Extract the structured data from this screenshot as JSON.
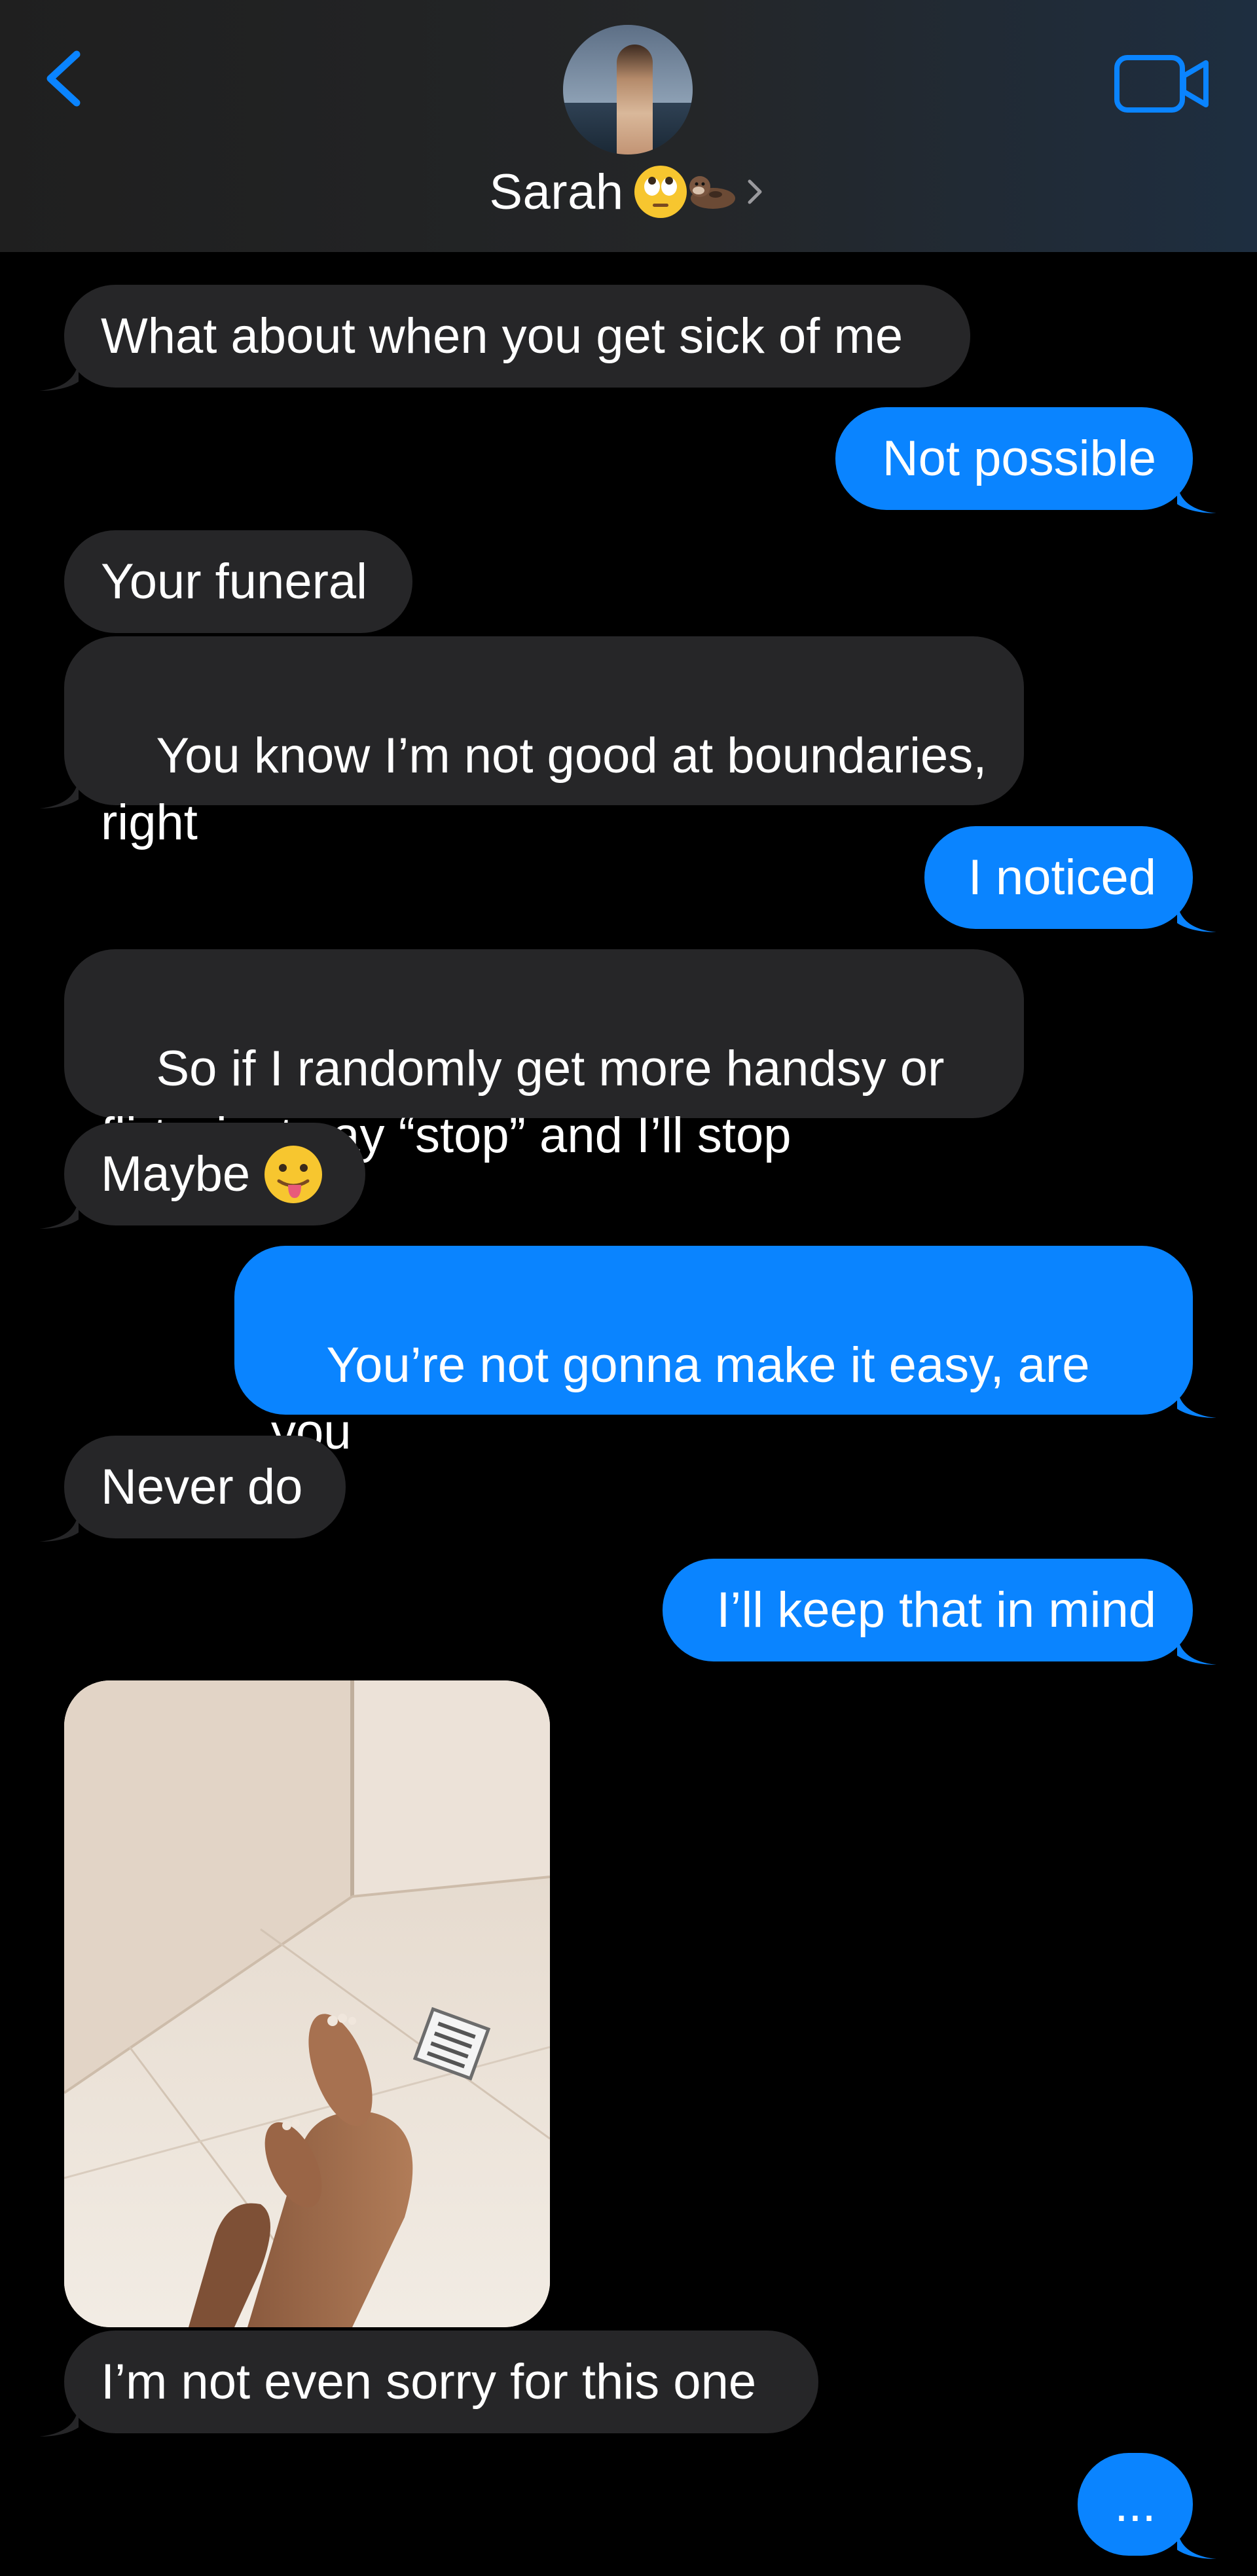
{
  "header": {
    "contact_name": "Sarah",
    "name_emoji_icons": [
      "eye-roll-emoji",
      "otter-emoji"
    ],
    "back_icon": "chevron-left-icon",
    "video_icon": "video-camera-icon",
    "accent_color": "#0a84ff"
  },
  "messages": [
    {
      "side": "in",
      "text": "What about when you get sick of me"
    },
    {
      "side": "out",
      "text": "Not possible"
    },
    {
      "side": "in",
      "text": "Your funeral"
    },
    {
      "side": "in",
      "text": "You know I’m not good at boundaries, right"
    },
    {
      "side": "out",
      "text": "I noticed"
    },
    {
      "side": "in",
      "text": "So if I randomly get more handsy or flirty, just say “stop” and I’ll stop"
    },
    {
      "side": "in",
      "text": "Maybe",
      "emoji": "tongue-out-emoji"
    },
    {
      "side": "out",
      "text": "You’re not gonna make it easy, are you"
    },
    {
      "side": "in",
      "text": "Never do"
    },
    {
      "side": "out",
      "text": "I’ll keep that in mind"
    },
    {
      "side": "in",
      "type": "photo",
      "subject": "shower-photo"
    },
    {
      "side": "in",
      "text": "I’m not even sorry for this one"
    },
    {
      "side": "out",
      "text": "..."
    }
  ],
  "colors": {
    "incoming_bubble": "#262628",
    "outgoing_bubble": "#0a84ff",
    "background": "#000000"
  }
}
